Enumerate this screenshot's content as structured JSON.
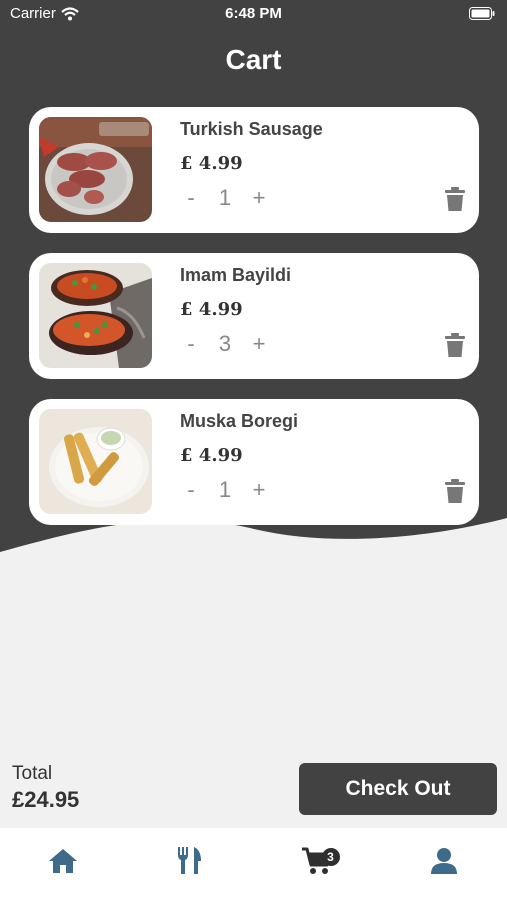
{
  "status_bar": {
    "carrier": "Carrier",
    "time": "6:48 PM"
  },
  "page_title": "Cart",
  "cart_items": [
    {
      "name": "Turkish Sausage",
      "price": "£ 4.99",
      "quantity": "1",
      "minus": "-",
      "plus": "+"
    },
    {
      "name": "Imam Bayildi",
      "price": "£ 4.99",
      "quantity": "3",
      "minus": "-",
      "plus": "+"
    },
    {
      "name": "Muska Boregi",
      "price": "£ 4.99",
      "quantity": "1",
      "minus": "-",
      "plus": "+"
    }
  ],
  "total": {
    "label": "Total",
    "amount": "£24.95"
  },
  "checkout_label": "Check Out",
  "tab_bar": {
    "items": [
      {
        "icon": "home-icon"
      },
      {
        "icon": "restaurant-icon"
      },
      {
        "icon": "cart-icon",
        "badge": "3"
      },
      {
        "icon": "person-icon"
      }
    ]
  },
  "colors": {
    "header_bg": "#424242",
    "body_bg": "#f1f1f1",
    "card_bg": "#ffffff",
    "accent_tab_icon": "#3e6b8a",
    "button_bg": "#424242"
  }
}
